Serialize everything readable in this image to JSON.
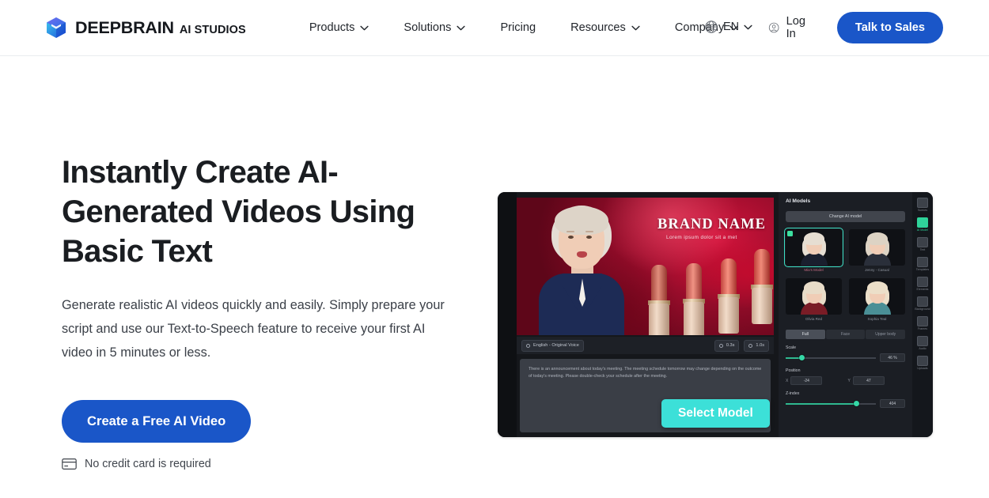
{
  "header": {
    "logo": {
      "name": "DEEPBRAIN",
      "suffix": "AI STUDIOS",
      "icon": "cube-logo-icon"
    },
    "nav": [
      {
        "label": "Products",
        "has_dropdown": true
      },
      {
        "label": "Solutions",
        "has_dropdown": true
      },
      {
        "label": "Pricing",
        "has_dropdown": false
      },
      {
        "label": "Resources",
        "has_dropdown": true
      },
      {
        "label": "Company",
        "has_dropdown": true
      }
    ],
    "language": {
      "label": "EN",
      "icon": "globe-icon"
    },
    "login": {
      "label": "Log In",
      "icon": "user-circle-icon"
    },
    "cta": {
      "label": "Talk to Sales",
      "color": "#1a56c8"
    }
  },
  "hero": {
    "title": "Instantly Create AI-Generated Videos Using Basic Text",
    "description": "Generate realistic AI videos quickly and easily. Simply prepare your script and use our Text-to-Speech feature to receive your first AI video in 5 minutes or less.",
    "cta_label": "Create a Free AI Video",
    "note": "No credit card is required",
    "note_icon": "credit-card-icon"
  },
  "mockup": {
    "video": {
      "brand_name": "BRAND NAME",
      "brand_tagline": "Lorem ipsum dolor sit a met"
    },
    "toolbar": {
      "language_chip": "English - Original Voice",
      "pause_chip": "0.3s",
      "duration_chip": "1.0s"
    },
    "script_text": "There is an announcement about today's meeting. The meeting schedule tomorrow may change depending on the outcome of today's meeting. Please double-check your schedule after the meeting.",
    "select_model_button": "Select Model",
    "panel": {
      "title": "AI Models",
      "change_button": "Change AI model",
      "models": [
        {
          "label": "Mia's Model",
          "selected": true,
          "hair": "#e6ded2",
          "body": "#1a1f2e"
        },
        {
          "label": "Jenny - Casual",
          "selected": false,
          "hair": "#ddd3c4",
          "body": "#2a2f3a"
        },
        {
          "label": "Olivia Red",
          "selected": false,
          "hair": "#e8dcc8",
          "body": "#7a1c26"
        },
        {
          "label": "Sophia Teal",
          "selected": false,
          "hair": "#ecdfc9",
          "body": "#4a8f96"
        }
      ],
      "tabs": [
        {
          "label": "Full",
          "active": true
        },
        {
          "label": "Face",
          "active": false
        },
        {
          "label": "Upper body",
          "active": false
        }
      ],
      "controls": [
        {
          "label": "Scale",
          "value": "46 %",
          "fill": 18
        },
        {
          "label": "Position",
          "x": "-24",
          "y": "47"
        },
        {
          "label": "Z-index",
          "value": "404",
          "fill": 78
        }
      ]
    },
    "tools": [
      {
        "label": "Scenes",
        "icon": "scenes-icon",
        "active": false
      },
      {
        "label": "AI Model",
        "icon": "ai-model-icon",
        "active": true
      },
      {
        "label": "Text",
        "icon": "text-icon",
        "active": false
      },
      {
        "label": "Templates",
        "icon": "templates-icon",
        "active": false
      },
      {
        "label": "Elements",
        "icon": "elements-icon",
        "active": false
      },
      {
        "label": "Background",
        "icon": "background-icon",
        "active": false
      },
      {
        "label": "Frames",
        "icon": "frames-icon",
        "active": false
      },
      {
        "label": "Audio",
        "icon": "audio-icon",
        "active": false
      },
      {
        "label": "Uploads",
        "icon": "uploads-icon",
        "active": false
      }
    ],
    "cursor_icon": "mouse-cursor-icon"
  }
}
